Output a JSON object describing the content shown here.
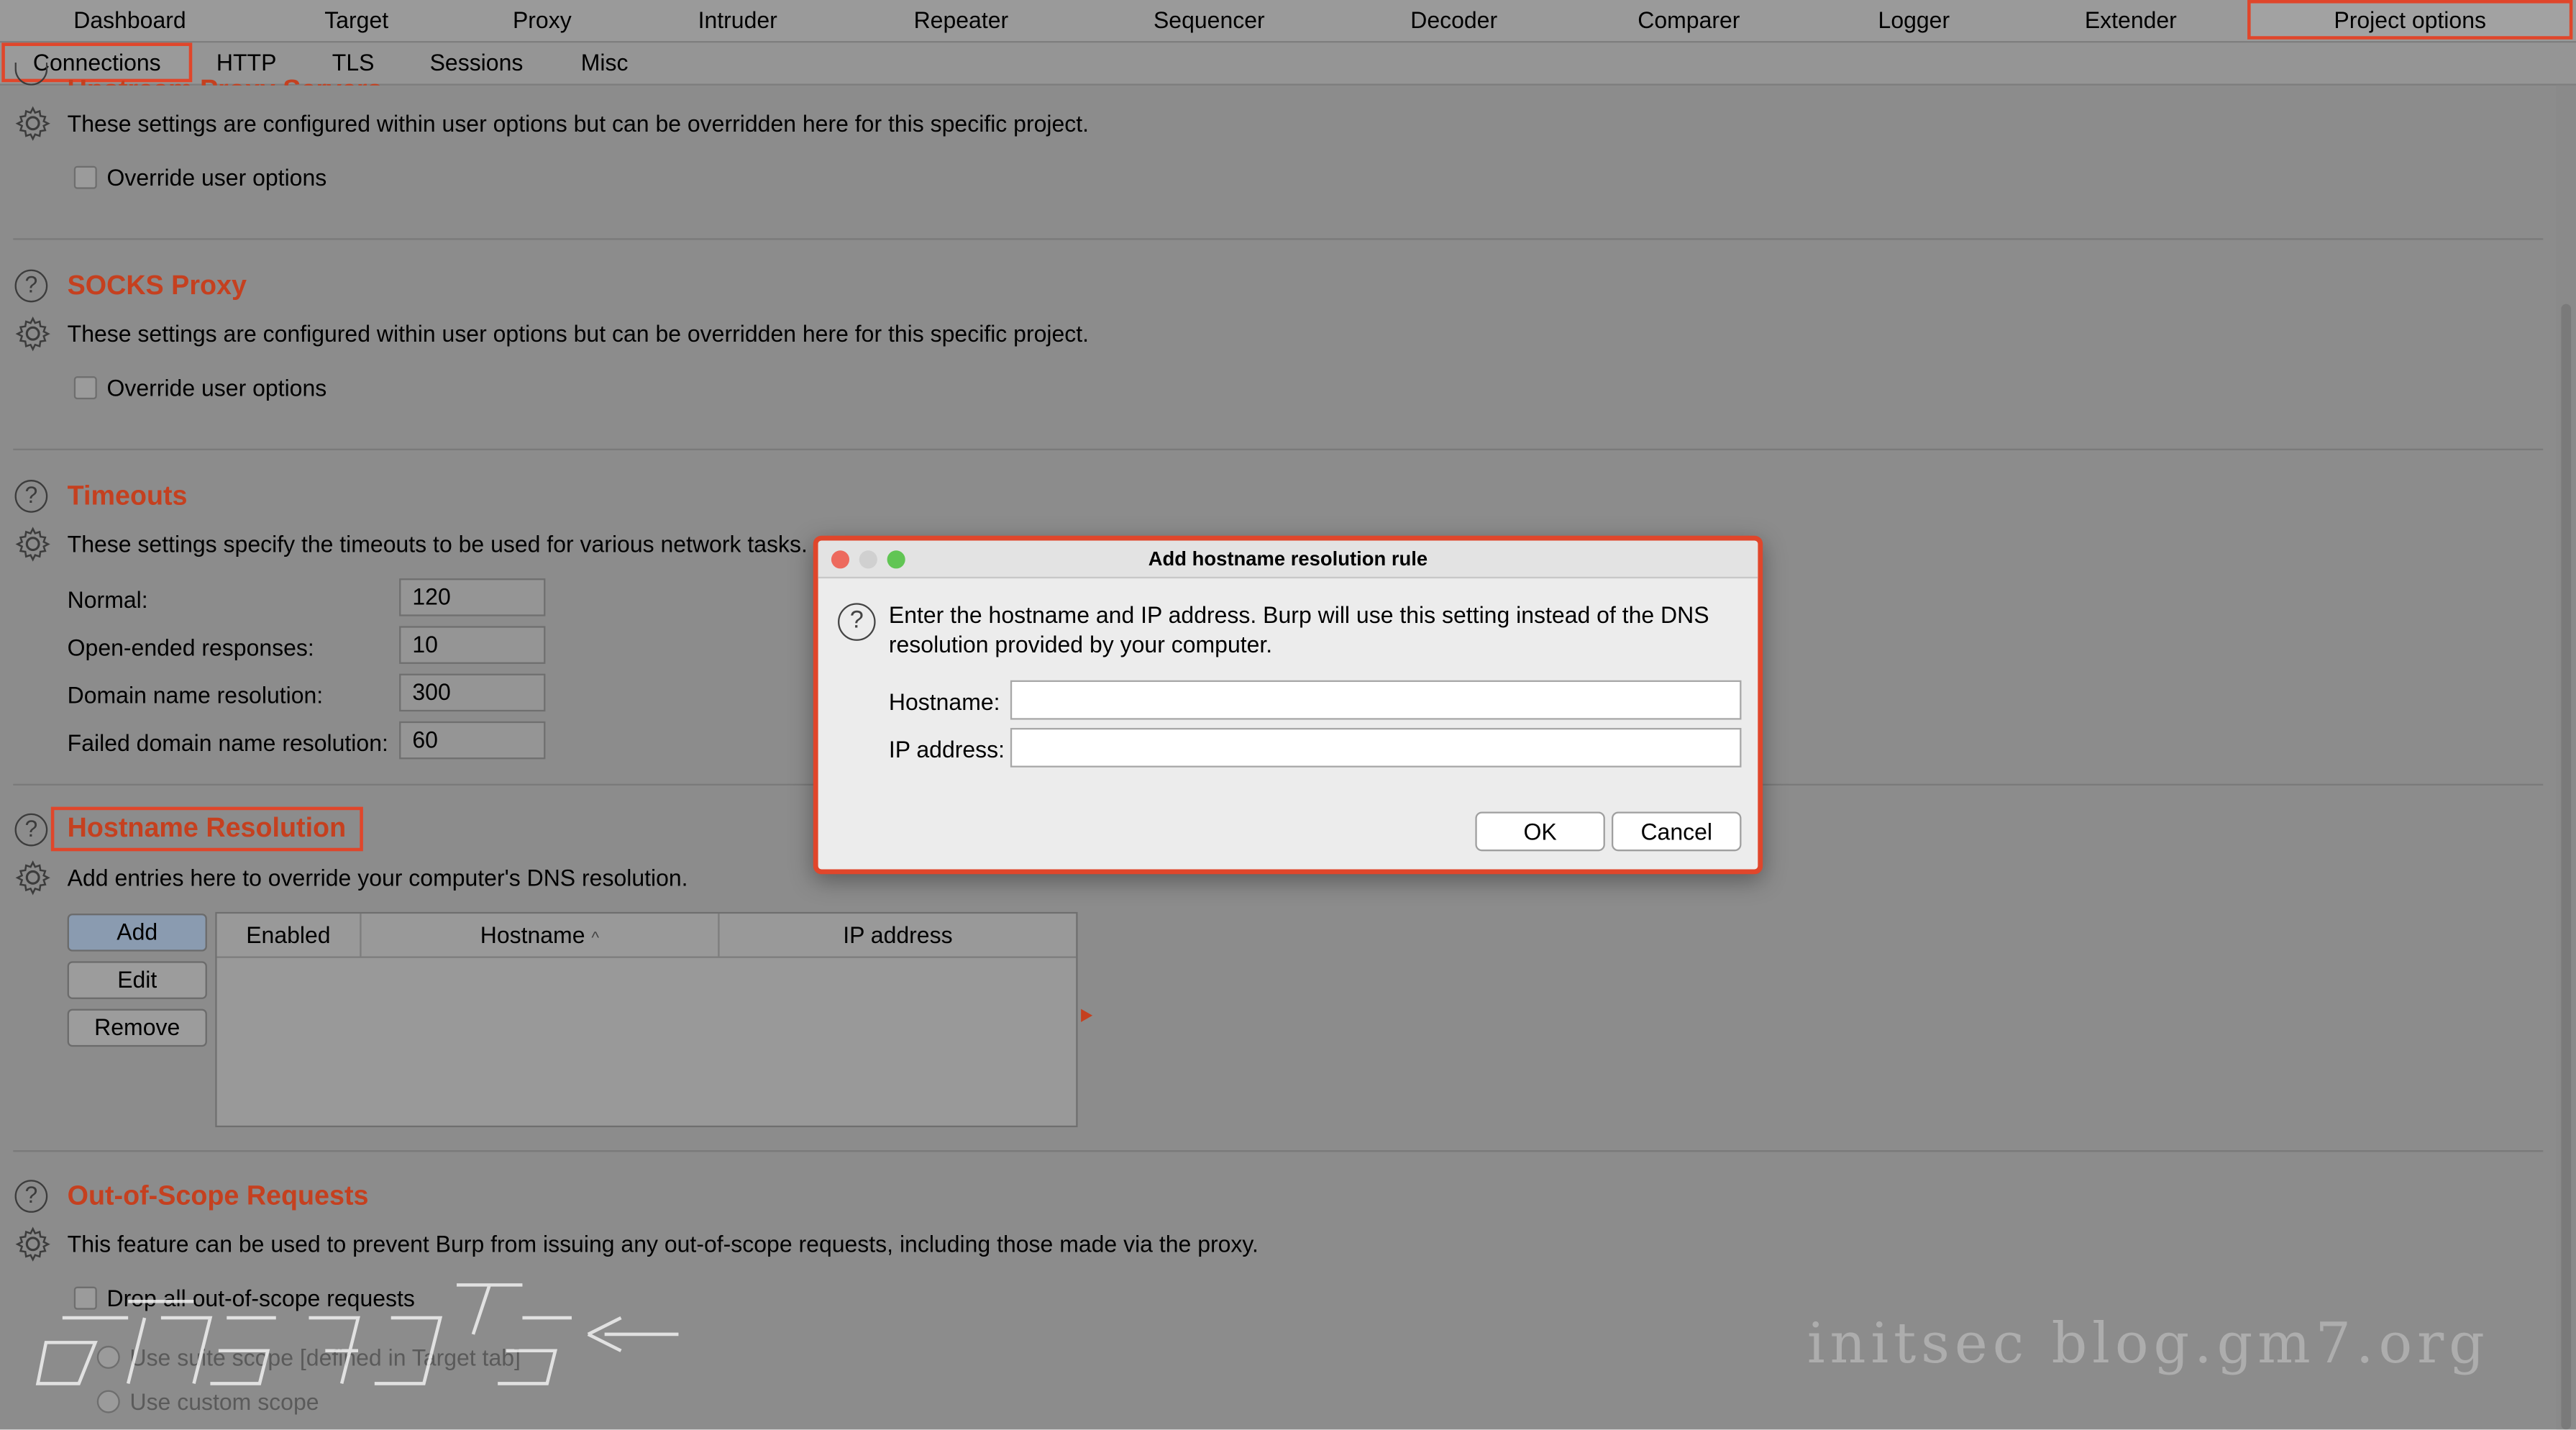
{
  "top_tabs": [
    "Dashboard",
    "Target",
    "Proxy",
    "Intruder",
    "Repeater",
    "Sequencer",
    "Decoder",
    "Comparer",
    "Logger",
    "Extender",
    "Project options"
  ],
  "active_top_tab": "Project options",
  "sub_tabs": [
    "Connections",
    "HTTP",
    "TLS",
    "Sessions",
    "Misc"
  ],
  "active_sub_tab": "Connections",
  "upstream": {
    "heading_partial": "Upstream Proxy Servers",
    "description": "These settings are configured within user options but can be overridden here for this specific project.",
    "override_label": "Override user options"
  },
  "socks": {
    "heading": "SOCKS Proxy",
    "description": "These settings are configured within user options but can be overridden here for this specific project.",
    "override_label": "Override user options"
  },
  "timeouts": {
    "heading": "Timeouts",
    "description": "These settings specify the timeouts to be used for various network tasks.",
    "fields": [
      {
        "label": "Normal:",
        "value": "120"
      },
      {
        "label": "Open-ended responses:",
        "value": "10"
      },
      {
        "label": "Domain name resolution:",
        "value": "300"
      },
      {
        "label": "Failed domain name resolution:",
        "value": "60"
      }
    ]
  },
  "hostname_resolution": {
    "heading": "Hostname Resolution",
    "description": "Add entries here to override your computer's DNS resolution.",
    "buttons": {
      "add": "Add",
      "edit": "Edit",
      "remove": "Remove"
    },
    "columns": [
      "Enabled",
      "Hostname",
      "IP address"
    ],
    "sort_indicator": "^"
  },
  "out_of_scope": {
    "heading": "Out-of-Scope Requests",
    "description": "This feature can be used to prevent Burp from issuing any out-of-scope requests, including those made via the proxy.",
    "drop_label": "Drop all out-of-scope requests",
    "radio_suite": "Use suite scope [defined in Target tab]",
    "radio_custom": "Use custom scope"
  },
  "dialog": {
    "title": "Add hostname resolution rule",
    "message": "Enter the hostname and IP address. Burp will use this setting instead of the DNS resolution provided by your computer.",
    "hostname_label": "Hostname:",
    "hostname_value": "",
    "ip_label": "IP address:",
    "ip_value": "",
    "ok_label": "OK",
    "cancel_label": "Cancel"
  },
  "watermark": "initsec blog.gm7.org",
  "colors": {
    "accent": "#e0462b",
    "heading": "#c5401f"
  }
}
